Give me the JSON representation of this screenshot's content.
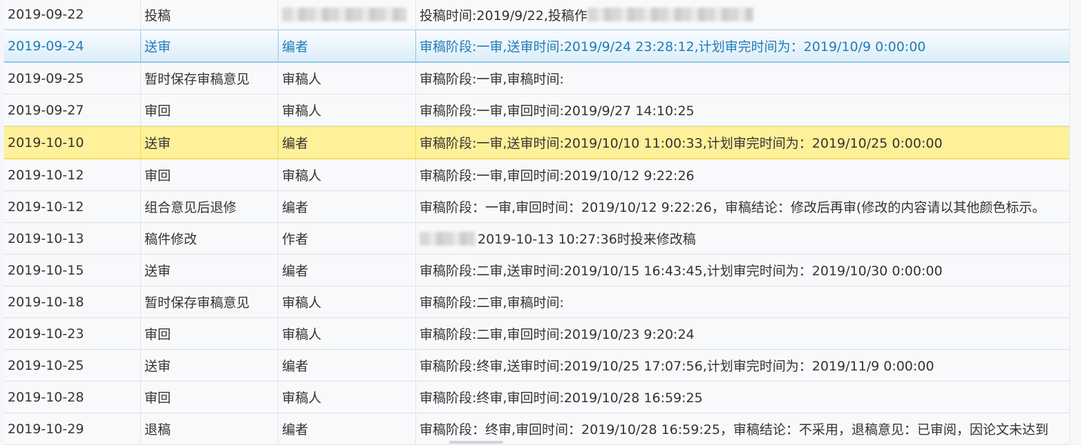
{
  "rows": [
    {
      "date": "2019-09-22",
      "action": "投稿",
      "role": "",
      "detail": "投稿时间:2019/9/22,投稿作",
      "redacted": true
    },
    {
      "date": "2019-09-24",
      "action": "送审",
      "role": "编者",
      "detail": "审稿阶段:一审,送审时间:2019/9/24 23:28:12,计划审完时间为：2019/10/9 0:00:00",
      "state": "selected"
    },
    {
      "date": "2019-09-25",
      "action": "暂时保存审稿意见",
      "role": "审稿人",
      "detail": "审稿阶段:一审,审稿时间:"
    },
    {
      "date": "2019-09-27",
      "action": "审回",
      "role": "审稿人",
      "detail": "审稿阶段:一审,审回时间:2019/9/27 14:10:25"
    },
    {
      "date": "2019-10-10",
      "action": "送审",
      "role": "编者",
      "detail": "审稿阶段:一审,送审时间:2019/10/10 11:00:33,计划审完时间为：2019/10/25 0:00:00",
      "state": "highlight"
    },
    {
      "date": "2019-10-12",
      "action": "审回",
      "role": "审稿人",
      "detail": "审稿阶段:一审,审回时间:2019/10/12 9:22:26"
    },
    {
      "date": "2019-10-12",
      "action": "组合意见后退修",
      "role": "编者",
      "detail": "审稿阶段：一审,审回时间：2019/10/12 9:22:26，审稿结论：修改后再审(修改的内容请以其他颜色标示。"
    },
    {
      "date": "2019-10-13",
      "action": "稿件修改",
      "role": "作者",
      "detail": "2019-10-13 10:27:36时投来修改稿",
      "redacted_prefix": true
    },
    {
      "date": "2019-10-15",
      "action": "送审",
      "role": "编者",
      "detail": "审稿阶段:二审,送审时间:2019/10/15 16:43:45,计划审完时间为：2019/10/30 0:00:00"
    },
    {
      "date": "2019-10-18",
      "action": "暂时保存审稿意见",
      "role": "审稿人",
      "detail": "审稿阶段:二审,审稿时间:"
    },
    {
      "date": "2019-10-23",
      "action": "审回",
      "role": "审稿人",
      "detail": "审稿阶段:二审,审回时间:2019/10/23 9:20:24"
    },
    {
      "date": "2019-10-25",
      "action": "送审",
      "role": "编者",
      "detail": "审稿阶段:终审,送审时间:2019/10/25 17:07:56,计划审完时间为：2019/11/9 0:00:00"
    },
    {
      "date": "2019-10-28",
      "action": "审回",
      "role": "审稿人",
      "detail": "审稿阶段:终审,审回时间:2019/10/28 16:59:25"
    },
    {
      "date": "2019-10-29",
      "action": "退稿",
      "role": "编者",
      "detail": "审稿阶段：终审,审回时间：2019/10/28 16:59:25，审稿结论：不采用，退稿意见：已审阅，因论文未达到"
    }
  ]
}
